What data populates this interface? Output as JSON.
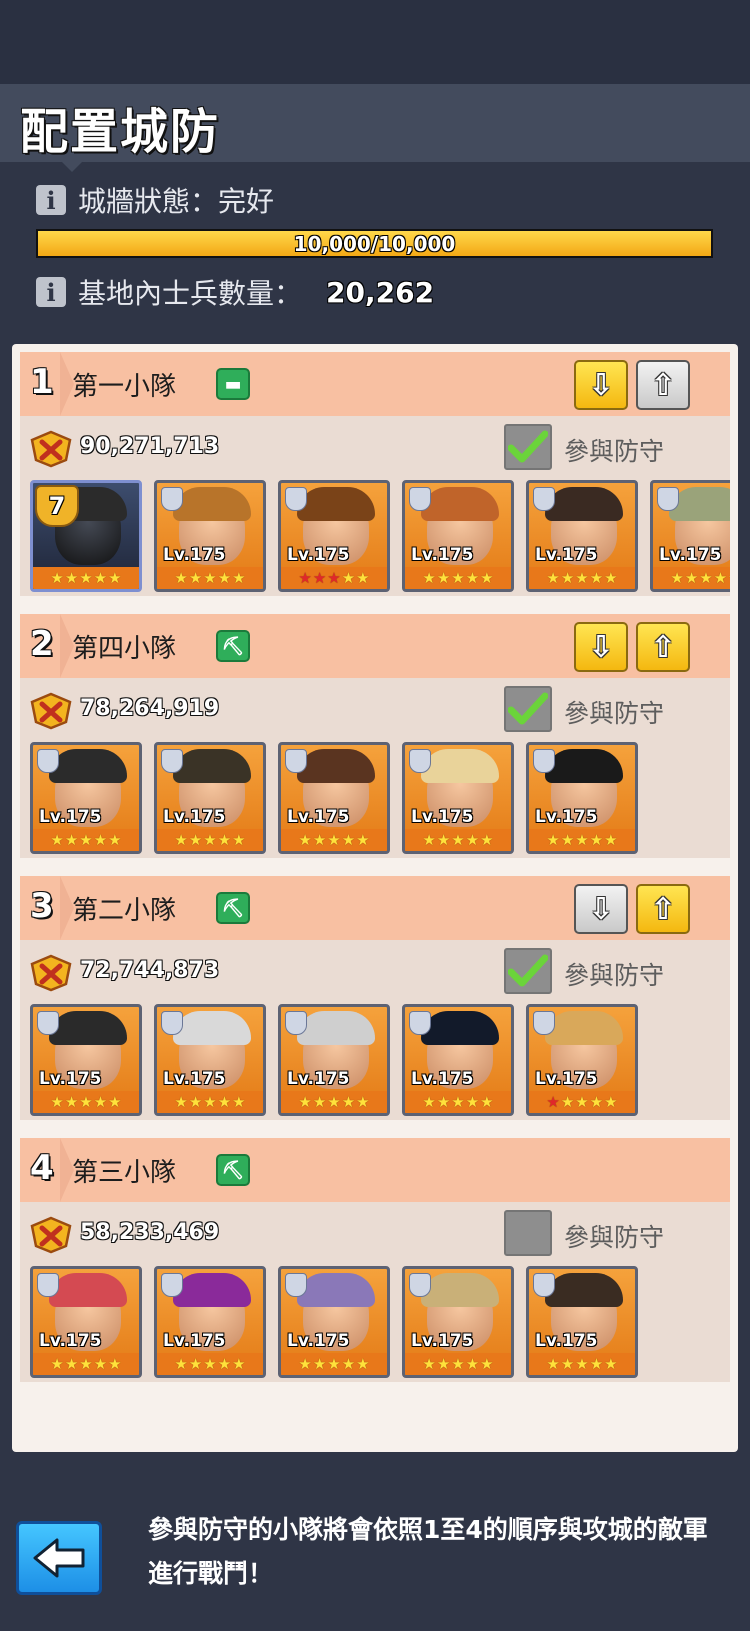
{
  "header": {
    "title": "配置城防"
  },
  "wall": {
    "status_label": "城牆狀態：完好",
    "hp_text": "10,000/10,000",
    "hp_fraction": 1.0,
    "soldiers_label": "基地內士兵數量：",
    "soldiers_value": "20,262",
    "info_icon": "i"
  },
  "defend_label": "參與防守",
  "squads": [
    {
      "number": "1",
      "name": "第一小隊",
      "type_icon": "truck-icon",
      "power": "90,271,713",
      "defending": true,
      "down_active": true,
      "up_active": false,
      "heroes": [
        {
          "level": "",
          "rank": "7",
          "stars": [
            "y",
            "y",
            "y",
            "y",
            "y"
          ],
          "hair": "#2b2b2b"
        },
        {
          "level": "Lv.175",
          "stars": [
            "y",
            "y",
            "y",
            "y",
            "y"
          ],
          "hair": "#b8742a"
        },
        {
          "level": "Lv.175",
          "stars": [
            "r",
            "r",
            "r",
            "y",
            "y"
          ],
          "hair": "#7a4318"
        },
        {
          "level": "Lv.175",
          "stars": [
            "y",
            "y",
            "y",
            "y",
            "y"
          ],
          "hair": "#c0642a"
        },
        {
          "level": "Lv.175",
          "stars": [
            "y",
            "y",
            "y",
            "y",
            "y"
          ],
          "hair": "#3a2a22"
        },
        {
          "level": "Lv.175",
          "stars": [
            "y",
            "y",
            "y",
            "y",
            "y"
          ],
          "hair": "#9aa37a"
        }
      ]
    },
    {
      "number": "2",
      "name": "第四小隊",
      "type_icon": "pickaxe-icon",
      "power": "78,264,919",
      "defending": true,
      "down_active": true,
      "up_active": true,
      "heroes": [
        {
          "level": "Lv.175",
          "stars": [
            "y",
            "y",
            "y",
            "y",
            "y"
          ],
          "hair": "#2b2b2b"
        },
        {
          "level": "Lv.175",
          "stars": [
            "y",
            "y",
            "y",
            "y",
            "y"
          ],
          "hair": "#3a3326"
        },
        {
          "level": "Lv.175",
          "stars": [
            "y",
            "y",
            "y",
            "y",
            "y"
          ],
          "hair": "#5a3420"
        },
        {
          "level": "Lv.175",
          "stars": [
            "y",
            "y",
            "y",
            "y",
            "y"
          ],
          "hair": "#e9d39a"
        },
        {
          "level": "Lv.175",
          "stars": [
            "y",
            "y",
            "y",
            "y",
            "y"
          ],
          "hair": "#1a1a1a"
        }
      ]
    },
    {
      "number": "3",
      "name": "第二小隊",
      "type_icon": "pickaxe-icon",
      "power": "72,744,873",
      "defending": true,
      "down_active": false,
      "up_active": true,
      "heroes": [
        {
          "level": "Lv.175",
          "stars": [
            "y",
            "y",
            "y",
            "y",
            "y"
          ],
          "hair": "#2a2a2a"
        },
        {
          "level": "Lv.175",
          "stars": [
            "y",
            "y",
            "y",
            "y",
            "y"
          ],
          "hair": "#d9d9d9"
        },
        {
          "level": "Lv.175",
          "stars": [
            "y",
            "y",
            "y",
            "y",
            "y"
          ],
          "hair": "#cfcfcf"
        },
        {
          "level": "Lv.175",
          "stars": [
            "y",
            "y",
            "y",
            "y",
            "y"
          ],
          "hair": "#121a2a"
        },
        {
          "level": "Lv.175",
          "stars": [
            "r",
            "y",
            "y",
            "y",
            "y"
          ],
          "hair": "#d9a85a"
        }
      ]
    },
    {
      "number": "4",
      "name": "第三小隊",
      "type_icon": "pickaxe-icon",
      "power": "58,233,469",
      "defending": false,
      "down_active": false,
      "up_active": false,
      "hide_moves": true,
      "heroes": [
        {
          "level": "Lv.175",
          "stars": [
            "y",
            "y",
            "y",
            "y",
            "y"
          ],
          "hair": "#d44a52"
        },
        {
          "level": "Lv.175",
          "stars": [
            "y",
            "y",
            "y",
            "y",
            "y"
          ],
          "hair": "#8a2a9a"
        },
        {
          "level": "Lv.175",
          "stars": [
            "y",
            "y",
            "y",
            "y",
            "y"
          ],
          "hair": "#8a78b8"
        },
        {
          "level": "Lv.175",
          "stars": [
            "y",
            "y",
            "y",
            "y",
            "y"
          ],
          "hair": "#c9b078"
        },
        {
          "level": "Lv.175",
          "stars": [
            "y",
            "y",
            "y",
            "y",
            "y"
          ],
          "hair": "#3a2c22"
        }
      ]
    }
  ],
  "footer": {
    "text": "參與防守的小隊將會依照1至4的順序與攻城的敵軍進行戰鬥！",
    "back_icon": "back-arrow-icon"
  },
  "colors": {
    "accent_gold": "#f4b810",
    "check_green": "#6bd43a",
    "back_blue": "#2ea8f4"
  }
}
